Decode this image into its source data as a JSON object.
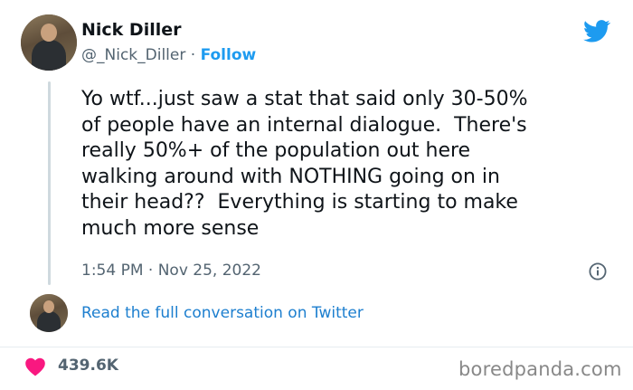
{
  "tweet": {
    "author_name": "Nick Diller",
    "handle": "@_Nick_Diller",
    "separator": "·",
    "follow_label": "Follow",
    "text": "Yo wtf...just saw a stat that said only 30-50%\nof people have an internal dialogue.  There's\nreally 50%+ of the population out here\nwalking around with NOTHING going on in\ntheir head??  Everything is starting to make\nmuch more sense",
    "timestamp": "1:54 PM · Nov 25, 2022",
    "read_conversation_label": "Read the full conversation on Twitter",
    "likes": "439.6K"
  },
  "watermark": "boredpanda.com",
  "colors": {
    "twitter_blue": "#1d9bf0",
    "heart_red": "#f91880",
    "muted_text": "#536471"
  },
  "icons": {
    "brand": "twitter-bird-icon",
    "info": "info-icon",
    "like": "heart-icon"
  }
}
